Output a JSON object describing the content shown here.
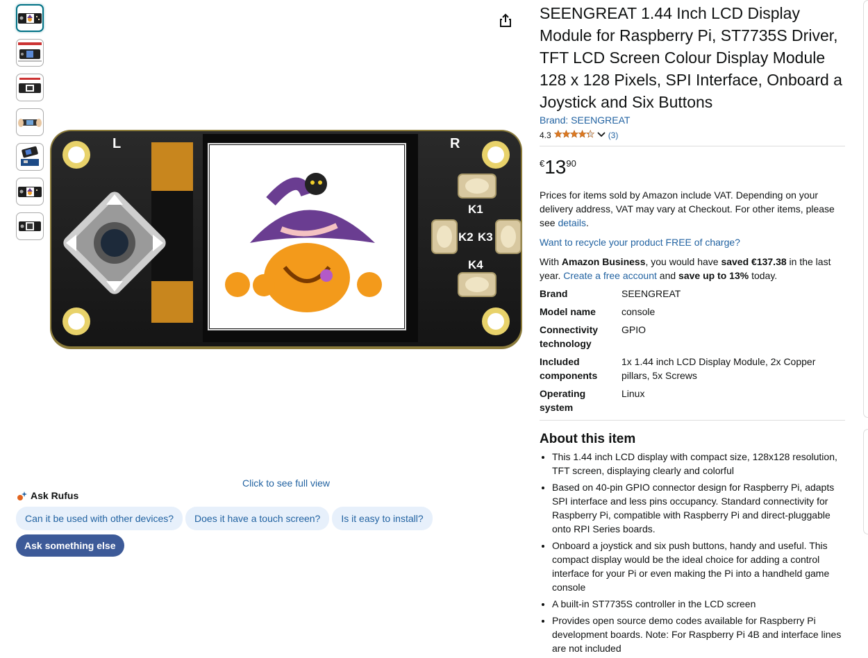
{
  "product": {
    "title": "SEENGREAT 1.44 Inch LCD Display Module for Raspberry Pi, ST7735S Driver, TFT LCD Screen Colour Display Module 128 x 128 Pixels, SPI Interface, Onboard a Joystick and Six Buttons",
    "brand_link": "Brand: SEENGREAT",
    "rating_value": "4.3",
    "rating_stars": 4.3,
    "rating_count": "(3)"
  },
  "price": {
    "currency": "€",
    "whole": "13",
    "fraction": "90"
  },
  "vat_notice": {
    "text": "Prices for items sold by Amazon include VAT. Depending on your delivery address, VAT may vary at Checkout. For other items, please see ",
    "link": "details",
    "end": "."
  },
  "recycle_link": "Want to recycle your product FREE of charge?",
  "business": {
    "t1": "With ",
    "b1": "Amazon Business",
    "t2": ", you would have ",
    "b2": "saved €137.38",
    "t3": " in the last year. ",
    "link": "Create a free account",
    "t4": " and ",
    "b3": "save up to 13%",
    "t5": " today."
  },
  "specs": [
    {
      "key": "Brand",
      "value": "SEENGREAT"
    },
    {
      "key": "Model name",
      "value": "console"
    },
    {
      "key": "Connectivity technology",
      "value": "GPIO"
    },
    {
      "key": "Included components",
      "value": "1x 1.44 inch LCD Display Module, 2x Copper pillars, 5x Screws"
    },
    {
      "key": "Operating system",
      "value": "Linux"
    }
  ],
  "about": {
    "heading": "About this item",
    "bullets": [
      "This 1.44 inch LCD display with compact size, 128x128 resolution, TFT screen, displaying clearly and colorful",
      "Based on 40-pin GPIO connector design for Raspberry Pi, adapts SPI interface and less pins occupancy. Standard connectivity for Raspberry Pi, compatible with Raspberry Pi and direct-pluggable onto RPI Series boards.",
      "Onboard a joystick and six push buttons, handy and useful. This compact display would be the ideal choice for adding a control interface for your Pi or even making the Pi into a handheld game console",
      "A built-in ST7735S controller in the LCD screen",
      "Provides open source demo codes available for Raspberry Pi development boards. Note: For Raspberry Pi 4B and interface lines are not included"
    ]
  },
  "gallery": {
    "full_view": "Click to see full view",
    "board_labels": {
      "left": "L",
      "right": "R",
      "k1": "K1",
      "k2": "K2",
      "k3": "K3",
      "k4": "K4"
    }
  },
  "rufus": {
    "title": "Ask Rufus",
    "chips": [
      "Can it be used with other devices?",
      "Does it have a touch screen?",
      "Is it easy to install?"
    ],
    "ask_else": "Ask something else"
  },
  "colors": {
    "link": "#2162a1",
    "star": "#de7921",
    "chip_bg": "#e7f0fb",
    "chip_dark": "#3d5a98"
  }
}
